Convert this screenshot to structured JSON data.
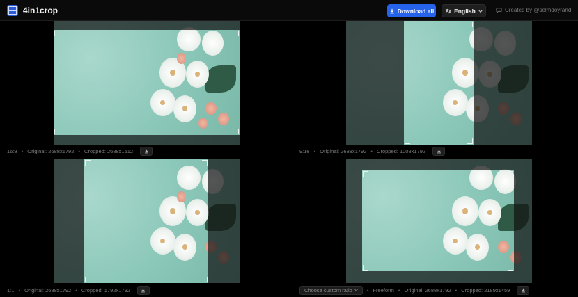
{
  "header": {
    "brand": "4in1crop",
    "logo_icon": "grid-logo-icon",
    "download_all_label": "Download all",
    "language_label": "English",
    "credit_text": "Created by @selmdoyrand"
  },
  "colors": {
    "accent": "#2563eb",
    "background": "#000000",
    "photo_mint": "#8ac7b8"
  },
  "panels": [
    {
      "ratio": "16:9",
      "original": "Original: 2688x1792",
      "cropped": "Cropped: 2688x1512"
    },
    {
      "ratio": "9:16",
      "original": "Original: 2688x1792",
      "cropped": "Cropped: 1008x1792"
    },
    {
      "ratio": "1:1",
      "original": "Original: 2688x1792",
      "cropped": "Cropped: 1792x1792"
    },
    {
      "ratio": "Freeform",
      "original": "Original: 2688x1792",
      "cropped": "Cropped: 2189x1459",
      "custom_ratio_label": "Choose custom ratio"
    }
  ],
  "separator": "•"
}
